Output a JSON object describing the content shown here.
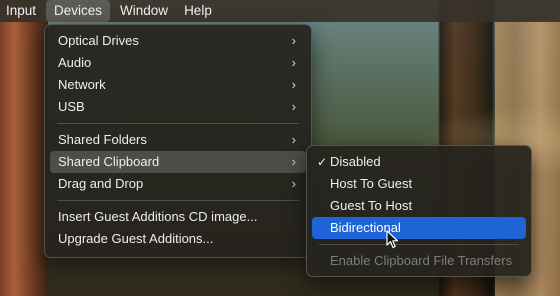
{
  "menubar": {
    "items": [
      "Input",
      "Devices",
      "Window",
      "Help"
    ],
    "active_index": 1
  },
  "devices_menu": {
    "group1": [
      "Optical Drives",
      "Audio",
      "Network",
      "USB"
    ],
    "group2": [
      "Shared Folders",
      "Shared Clipboard",
      "Drag and Drop"
    ],
    "group3": [
      "Insert Guest Additions CD image...",
      "Upgrade Guest Additions..."
    ],
    "highlighted_item": "Shared Clipboard"
  },
  "clipboard_submenu": {
    "options": [
      "Disabled",
      "Host To Guest",
      "Guest To Host",
      "Bidirectional"
    ],
    "checked": "Disabled",
    "checkmark": "✓",
    "hovered": "Bidirectional",
    "disabled_item": "Enable Clipboard File Transfers"
  },
  "icons": {
    "submenu_arrow": "chevron-right-icon",
    "check": "checkmark-icon",
    "cursor": "mouse-pointer-icon"
  },
  "colors": {
    "highlight": "#1f64d6",
    "menu_bg": "#26241e",
    "disabled_text": "#7e7d78"
  }
}
